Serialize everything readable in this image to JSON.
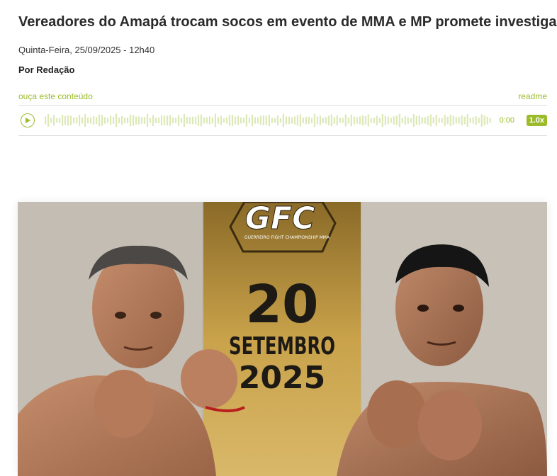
{
  "article": {
    "headline": "Vereadores do Amapá trocam socos em evento de MMA e MP promete investigar",
    "date": "Quinta-Feira, 25/09/2025 - 12h40",
    "byline": "Por Redação"
  },
  "audio_player": {
    "listen_label": "ouça este conteúdo",
    "brand": "readme",
    "time": "0:00",
    "speed": "1.0x",
    "accent_color": "#9bbb2a"
  },
  "photo": {
    "logo_text": "GFC",
    "logo_subtitle": "GUERREIRO FIGHT CHAMPIONSHIP MMA",
    "day": "20",
    "month": "SETEMBRO",
    "year": "2025"
  },
  "icons": [
    "play-icon",
    "waveform-icon"
  ]
}
